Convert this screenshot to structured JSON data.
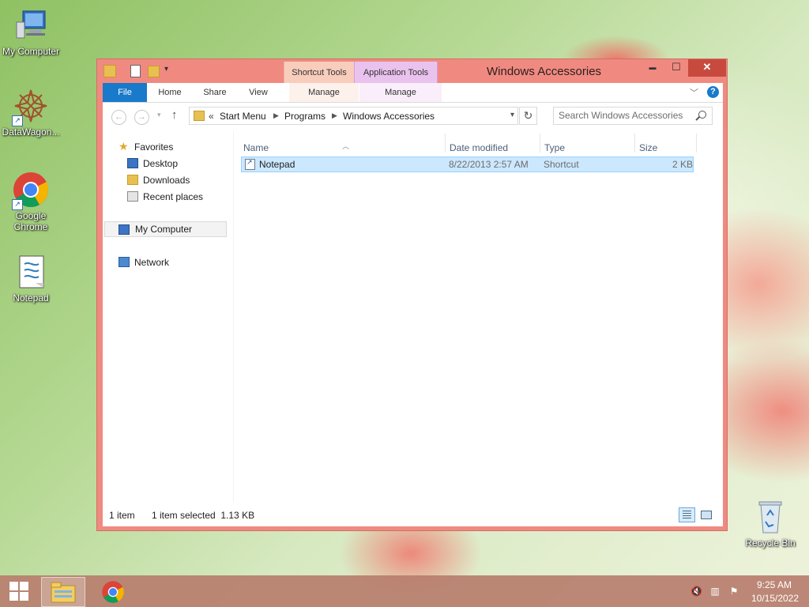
{
  "desktop": {
    "icons": [
      {
        "label": "My Computer"
      },
      {
        "label": "DataWagon..."
      },
      {
        "label": "Google Chrome"
      },
      {
        "label": "Notepad"
      },
      {
        "label": "Recycle Bin"
      }
    ]
  },
  "window": {
    "title": "Windows Accessories",
    "context_tabs": {
      "shortcut_tools": "Shortcut Tools",
      "application_tools": "Application Tools"
    },
    "controls": {
      "minimize": "▬",
      "maximize": "☐",
      "close": "✕"
    },
    "ribbon_tabs": {
      "file": "File",
      "home": "Home",
      "share": "Share",
      "view": "View",
      "manage_shortcut": "Manage",
      "manage_app": "Manage"
    },
    "help": "?"
  },
  "address": {
    "overflow": "«",
    "crumbs": [
      "Start Menu",
      "Programs",
      "Windows Accessories"
    ],
    "search_placeholder": "Search Windows Accessories"
  },
  "nav_pane": {
    "favorites": "Favorites",
    "desktop": "Desktop",
    "downloads": "Downloads",
    "recent_places": "Recent places",
    "my_computer": "My Computer",
    "network": "Network"
  },
  "columns": {
    "name": "Name",
    "date_modified": "Date modified",
    "type": "Type",
    "size": "Size"
  },
  "files": [
    {
      "name": "Notepad",
      "date_modified": "8/22/2013 2:57 AM",
      "type": "Shortcut",
      "size": "2 KB"
    }
  ],
  "status": {
    "count": "1 item",
    "selected": "1 item selected  1.13 KB"
  },
  "taskbar": {
    "time": "9:25 AM",
    "date": "10/15/2022"
  },
  "colors": {
    "accent": "#1979ca",
    "window_frame": "#f08a80",
    "selection": "#cce8ff"
  }
}
